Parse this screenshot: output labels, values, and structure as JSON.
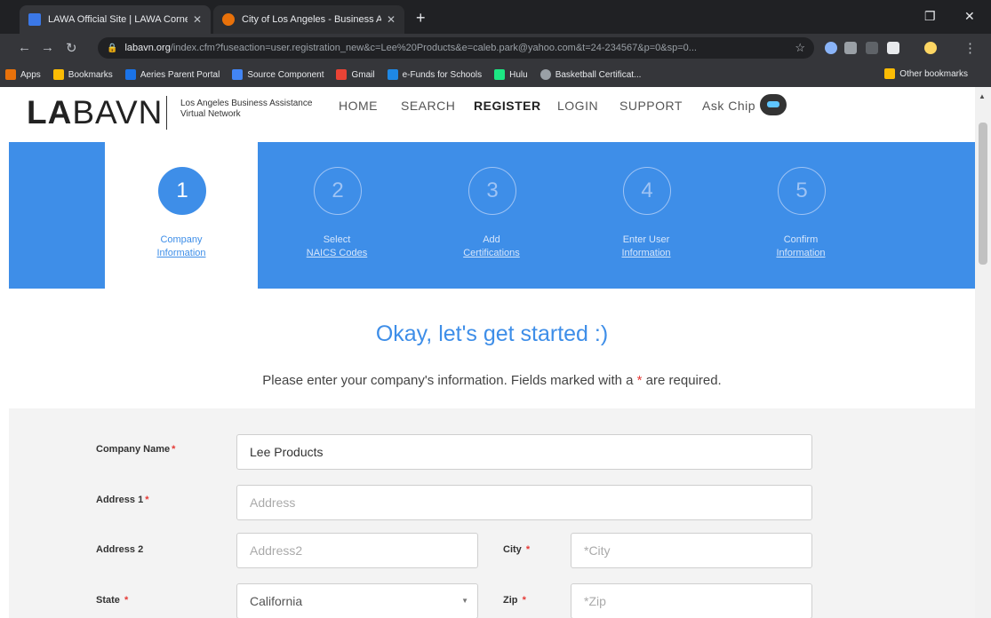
{
  "browser": {
    "tabs": [
      {
        "title": "LAWA Official Site | LAWA Corner",
        "close": "✕"
      },
      {
        "title": "City of Los Angeles - Business Ass",
        "close": "✕"
      }
    ],
    "new_tab": "+",
    "url_host": "labavn.org",
    "url_rest": "/index.cfm?fuseaction=user.registration_new&c=Lee%20Products&e=caleb.park@yahoo.com&t=24-234567&p=0&sp=0...",
    "bookmarks": [
      {
        "label": "Apps",
        "color": "#e8710a"
      },
      {
        "label": "Bookmarks",
        "color": "#fbbc04"
      },
      {
        "label": "Aeries Parent Portal",
        "color": "#1a73e8"
      },
      {
        "label": "Source Component",
        "color": "#4285f4"
      },
      {
        "label": "Gmail",
        "color": "#ea4335"
      },
      {
        "label": "e-Funds for Schools",
        "color": "#1e88e5"
      },
      {
        "label": "Hulu",
        "color": "#1ce783"
      },
      {
        "label": "Basketball Certificat...",
        "color": "#9aa0a6"
      }
    ],
    "other_bookmarks": "Other bookmarks"
  },
  "site": {
    "logo_la": "LA",
    "logo_bavn": "BAVN",
    "tagline": "Los Angeles Business Assistance Virtual Network",
    "nav": [
      "HOME",
      "SEARCH",
      "REGISTER",
      "LOGIN",
      "SUPPORT",
      "Ask Chip"
    ]
  },
  "steps": [
    {
      "number": "1",
      "line1": "Company",
      "line2": "Information"
    },
    {
      "number": "2",
      "line1": "Select",
      "line2": "NAICS Codes"
    },
    {
      "number": "3",
      "line1": "Add",
      "line2": "Certifications"
    },
    {
      "number": "4",
      "line1": "Enter User",
      "line2": "Information"
    },
    {
      "number": "5",
      "line1": "Confirm",
      "line2": "Information"
    }
  ],
  "intro": {
    "heading": "Okay, let's get started :)",
    "sub_before": "Please enter your company's information. Fields marked with a",
    "sub_star": "*",
    "sub_after": "are required."
  },
  "form": {
    "required_mark": "*",
    "company_name": {
      "label": "Company Name",
      "value": "Lee Products"
    },
    "address1": {
      "label": "Address 1",
      "placeholder": "Address"
    },
    "address2": {
      "label": "Address 2",
      "placeholder": "Address2"
    },
    "city": {
      "label": "City",
      "placeholder": "*City"
    },
    "state": {
      "label": "State",
      "value": "California"
    },
    "zip": {
      "label": "Zip",
      "placeholder": "*Zip"
    }
  },
  "colors": {
    "brand_blue": "#3e8ee8",
    "required_red": "#e53935"
  }
}
